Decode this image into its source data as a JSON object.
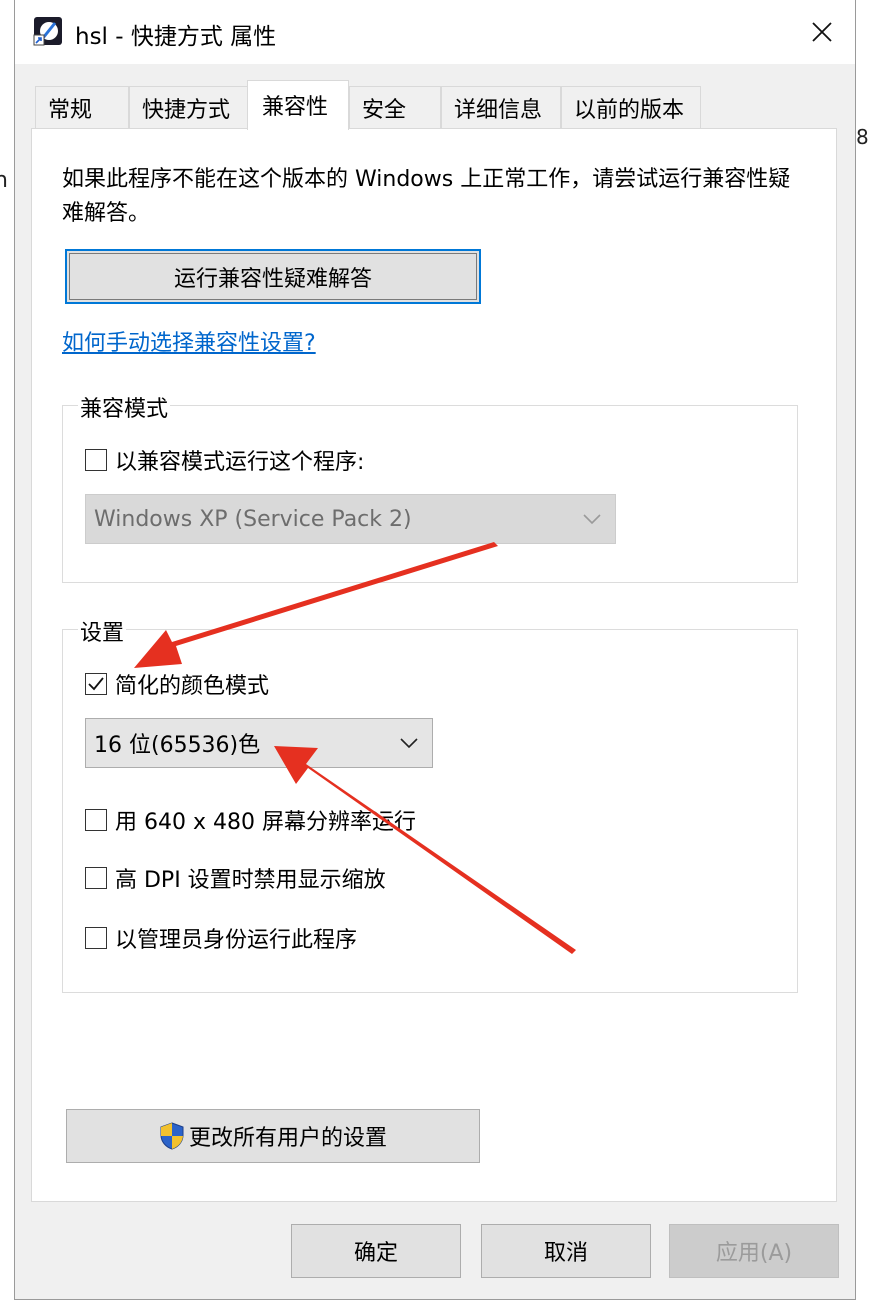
{
  "edge": {
    "left_char": "n",
    "right_char": "8"
  },
  "window": {
    "title": "hsl - 快捷方式 属性",
    "close_glyph": "✕"
  },
  "tabs": [
    {
      "label": "常规",
      "active": false
    },
    {
      "label": "快捷方式",
      "active": false
    },
    {
      "label": "兼容性",
      "active": true
    },
    {
      "label": "安全",
      "active": false
    },
    {
      "label": "详细信息",
      "active": false
    },
    {
      "label": "以前的版本",
      "active": false
    }
  ],
  "compat": {
    "info": "如果此程序不能在这个版本的 Windows 上正常工作，请尝试运行兼容性疑难解答。",
    "run_troubleshooter": "运行兼容性疑难解答",
    "manual_link": "如何手动选择兼容性设置?",
    "mode_group": {
      "label": "兼容模式",
      "checkbox_label": "以兼容模式运行这个程序:",
      "checked": false,
      "select_value": "Windows XP (Service Pack 2)"
    },
    "settings_group": {
      "label": "设置",
      "reduced_color": {
        "label": "简化的颜色模式",
        "checked": true
      },
      "color_select_value": "16 位(65536)色",
      "res_640": {
        "label": "用 640 x 480 屏幕分辨率运行",
        "checked": false
      },
      "high_dpi": {
        "label": "高 DPI 设置时禁用显示缩放",
        "checked": false
      },
      "run_admin": {
        "label": "以管理员身份运行此程序",
        "checked": false
      }
    },
    "all_users_button": "更改所有用户的设置"
  },
  "footer": {
    "ok": "确定",
    "cancel": "取消",
    "apply": "应用(A)"
  },
  "colors": {
    "accent": "#0078d7",
    "link": "#0066cc",
    "annotation_arrow": "#e53020"
  },
  "icons": {
    "app": "shortcut-app-icon",
    "shield": "uac-shield-icon",
    "close": "close-icon",
    "chevron": "chevron-down-icon",
    "check": "checkmark-icon"
  }
}
